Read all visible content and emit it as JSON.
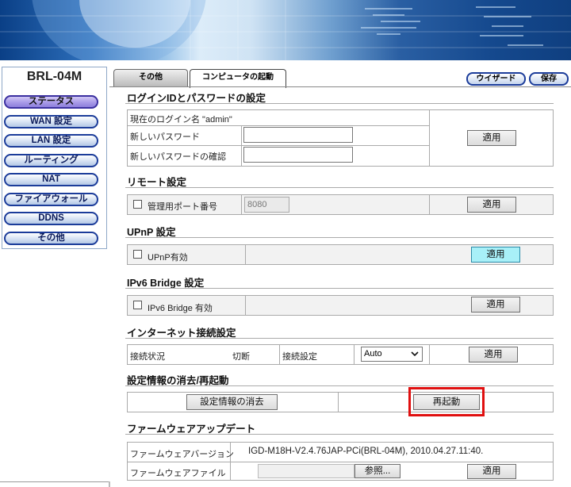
{
  "model": "BRL-04M",
  "nav": [
    {
      "label": "ステータス",
      "active": true
    },
    {
      "label": "WAN 設定",
      "active": false
    },
    {
      "label": "LAN 設定",
      "active": false
    },
    {
      "label": "ルーティング",
      "active": false
    },
    {
      "label": "NAT",
      "active": false
    },
    {
      "label": "ファイアウォール",
      "active": false
    },
    {
      "label": "DDNS",
      "active": false
    },
    {
      "label": "その他",
      "active": false
    }
  ],
  "tabs": {
    "other": "その他",
    "restart": "コンピュータの起動"
  },
  "top_buttons": {
    "wizard": "ウイザード",
    "save": "保存"
  },
  "login": {
    "title": "ログインIDとパスワードの設定",
    "current_login": "現在のログイン名 \"admin\"",
    "new_password_label": "新しいパスワード",
    "confirm_password_label": "新しいパスワードの確認",
    "apply": "適用"
  },
  "remote": {
    "title": "リモート設定",
    "port_label": "管理用ポート番号",
    "port_value": "8080",
    "apply": "適用"
  },
  "upnp": {
    "title": "UPnP 設定",
    "enable_label": "UPnP有効",
    "apply": "適用"
  },
  "ipv6": {
    "title": "IPv6 Bridge 設定",
    "enable_label": "IPv6 Bridge 有効",
    "apply": "適用"
  },
  "internet": {
    "title": "インターネット接続設定",
    "status_label": "接続状況",
    "status_value": "切断",
    "setting_label": "接続設定",
    "setting_value": "Auto",
    "apply": "適用"
  },
  "reset": {
    "title": "設定情報の消去/再起動",
    "clear_button": "設定情報の消去",
    "restart_button": "再起動"
  },
  "firmware": {
    "title": "ファームウェアアップデート",
    "version_label": "ファームウェアバージョン",
    "version_value": "IGD-M18H-V2.4.76JAP-PCi(BRL-04M), 2010.04.27.11:40.",
    "file_label": "ファームウェアファイル",
    "browse_button": "参照...",
    "apply": "適用"
  },
  "colors": {
    "highlight_button": "#a8f0f8",
    "restart_outline": "#e01010",
    "nav_border": "#1b3c9a"
  }
}
